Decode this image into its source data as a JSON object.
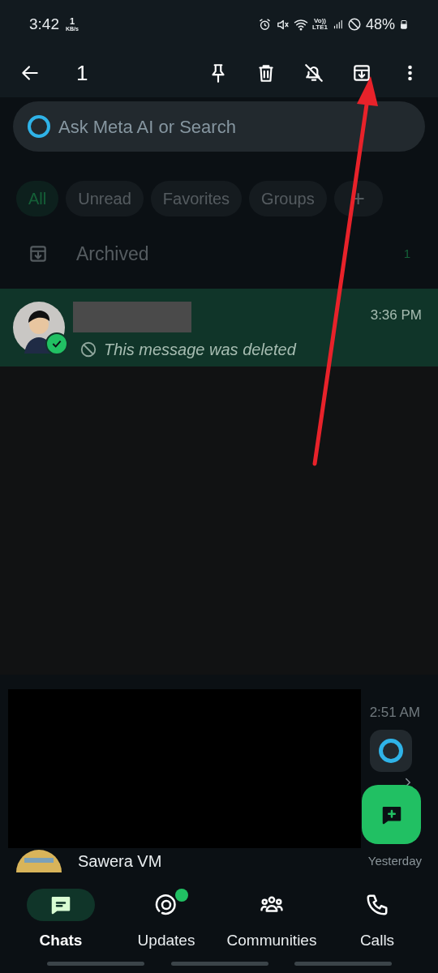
{
  "status_bar": {
    "time": "3:42",
    "speed_value": "1",
    "speed_unit": "KB/s",
    "network_top": "Vo))",
    "network_bottom": "LTE1",
    "battery": "48%"
  },
  "selection_bar": {
    "count": "1"
  },
  "search": {
    "placeholder": "Ask Meta AI or Search"
  },
  "filters": [
    {
      "label": "All",
      "selected": true
    },
    {
      "label": "Unread",
      "selected": false
    },
    {
      "label": "Favorites",
      "selected": false
    },
    {
      "label": "Groups",
      "selected": false
    }
  ],
  "add_filter": "+",
  "archived": {
    "label": "Archived",
    "count": "1"
  },
  "chats": [
    {
      "kind": "redacted",
      "time": "3:36 PM",
      "message": "This message was deleted",
      "deleted": true,
      "selected": true
    },
    {
      "kind": "blacked_out",
      "time": "2:51 AM",
      "selected": false
    },
    {
      "kind": "partial",
      "name": "Sawera VM",
      "time": "Yesterday",
      "selected": false
    }
  ],
  "nav": [
    {
      "label": "Chats",
      "selected": true,
      "badge": false
    },
    {
      "label": "Updates",
      "selected": false,
      "badge": true
    },
    {
      "label": "Communities",
      "selected": false,
      "badge": false
    },
    {
      "label": "Calls",
      "selected": false,
      "badge": false
    }
  ]
}
